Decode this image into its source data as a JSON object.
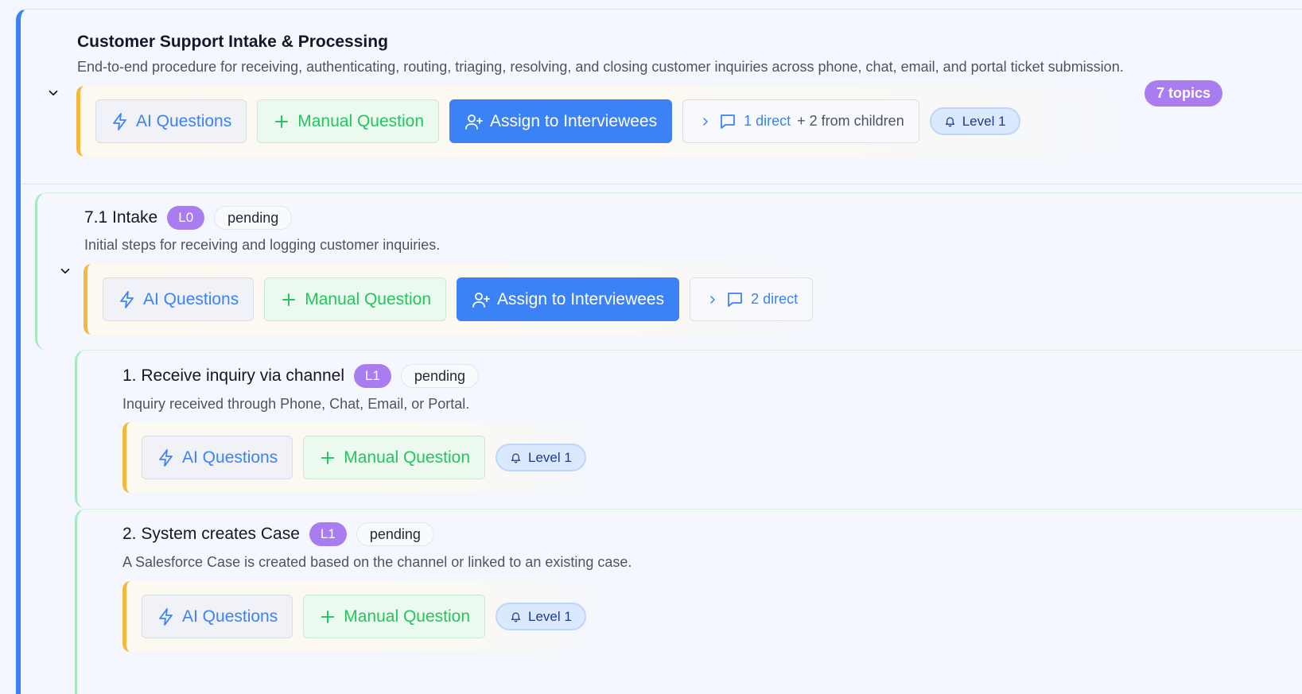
{
  "root": {
    "title": "Customer Support Intake & Processing",
    "description": "End-to-end procedure for receiving, authenticating, routing, triaging, resolving, and closing customer inquiries across phone, chat, email, and portal ticket submission.",
    "topics_badge": "7 topics",
    "ai_label": "AI Questions",
    "manual_label": "Manual Question",
    "assign_label": "Assign to Interviewees",
    "comments_direct": "1 direct",
    "comments_plus": "+ 2 from children",
    "level_label": "Level 1"
  },
  "section": {
    "title": "7.1 Intake",
    "level": "L0",
    "status": "pending",
    "description": "Initial steps for receiving and logging customer inquiries.",
    "ai_label": "AI Questions",
    "manual_label": "Manual Question",
    "assign_label": "Assign to Interviewees",
    "comments_direct": "2 direct"
  },
  "steps": [
    {
      "title": "1. Receive inquiry via channel",
      "level": "L1",
      "status": "pending",
      "description": "Inquiry received through Phone, Chat, Email, or Portal.",
      "ai_label": "AI Questions",
      "manual_label": "Manual Question",
      "level_label": "Level 1"
    },
    {
      "title": "2. System creates Case",
      "level": "L1",
      "status": "pending",
      "description": "A Salesforce Case is created based on the channel or linked to an existing case.",
      "ai_label": "AI Questions",
      "manual_label": "Manual Question",
      "level_label": "Level 1"
    }
  ],
  "colors": {
    "primary": "#3b82f6",
    "success": "#22c55e",
    "accent_purple": "#a97cf0",
    "toolbar_accent": "#f6b83c",
    "node_border": "#a7e8c0"
  }
}
